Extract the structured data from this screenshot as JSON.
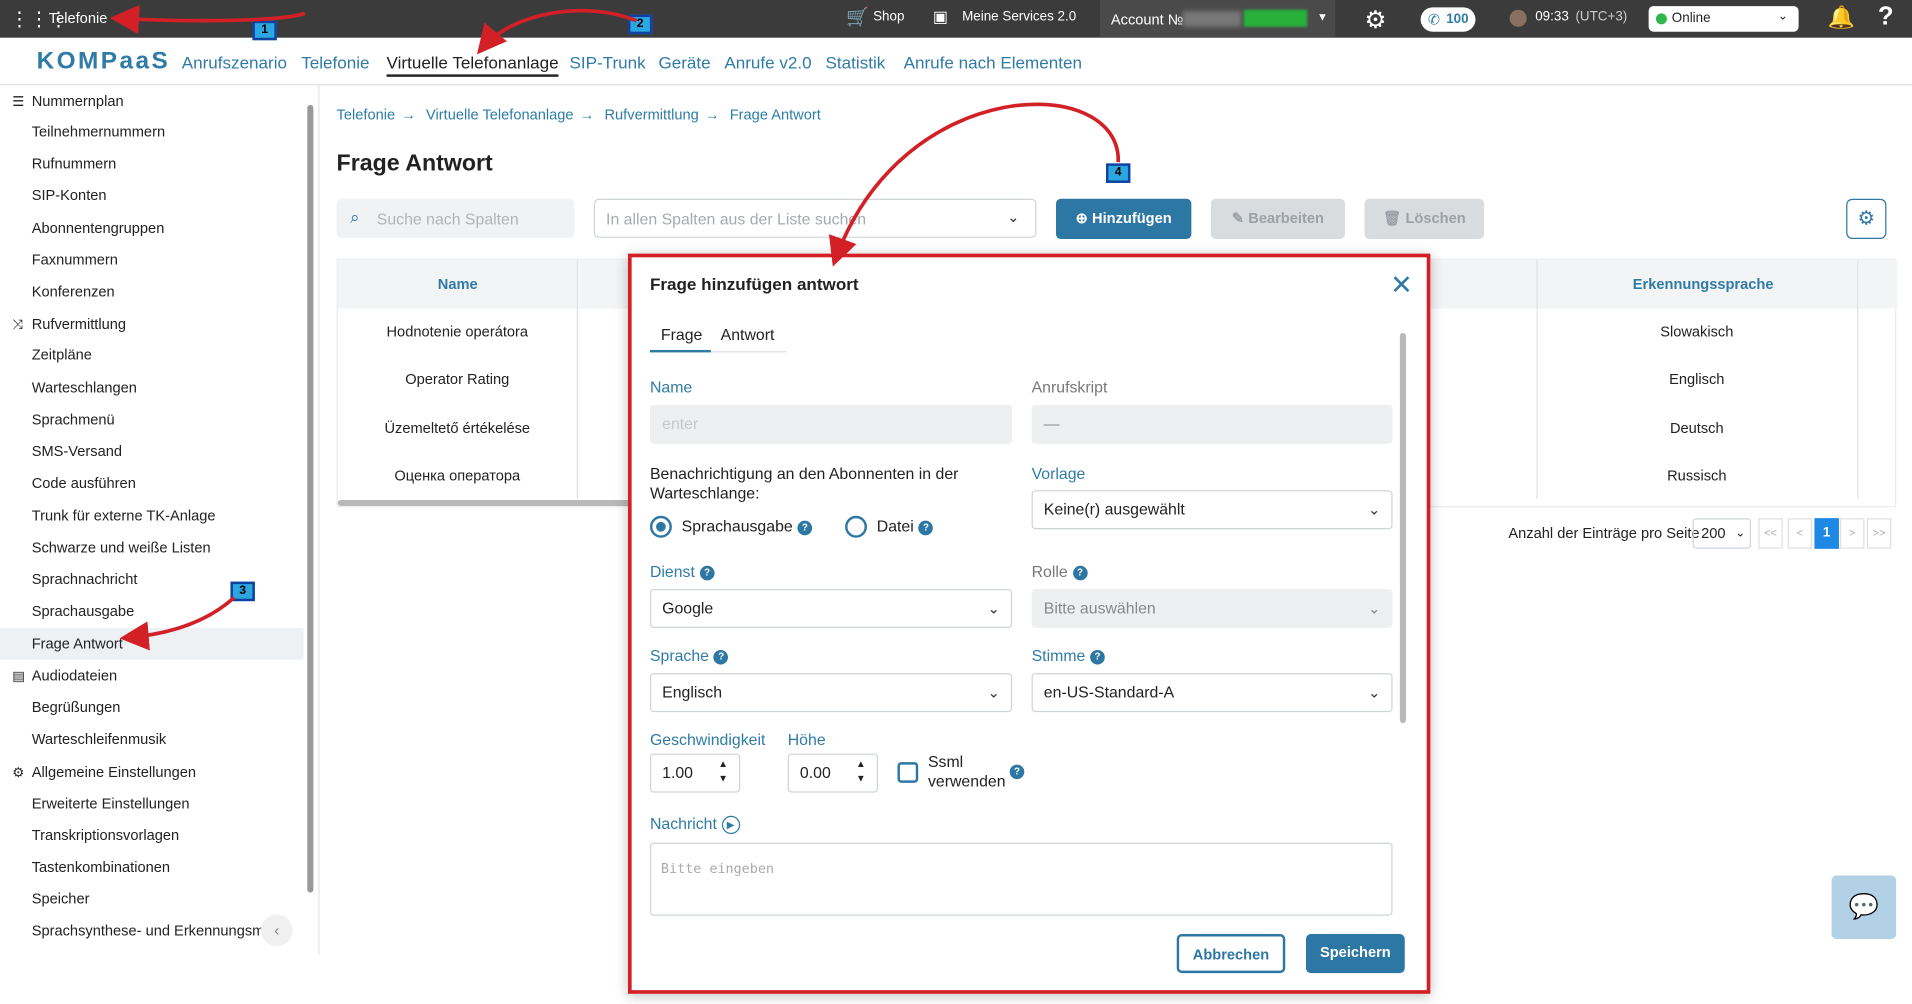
{
  "topbar": {
    "app_title": "Telefonie",
    "shop": "Shop",
    "services": "Meine Services 2.0",
    "account": "Account №",
    "calls_count": "100",
    "time": "09:33",
    "timezone": "(UTC+3)",
    "status": "Online",
    "icons": [
      "apps-grid-icon",
      "cart-icon",
      "services-icon",
      "gear-icon",
      "phone-icon",
      "user-avatar-icon",
      "bell-icon",
      "help-icon"
    ]
  },
  "nav": {
    "logo": "KOMPaaS",
    "items": [
      "Anrufszenario",
      "Telefonie",
      "Virtuelle Telefonanlage",
      "SIP-Trunk",
      "Geräte",
      "Anrufe v2.0",
      "Statistik",
      "Anrufe nach Elementen"
    ]
  },
  "sidebar": {
    "sections": [
      {
        "title": "Nummernplan",
        "items": [
          "Teilnehmernummern",
          "Rufnummern",
          "SIP-Konten",
          "Abonnentengruppen",
          "Faxnummern",
          "Konferenzen"
        ]
      },
      {
        "title": "Rufvermittlung",
        "items": [
          "Zeitpläne",
          "Warteschlangen",
          "Sprachmenü",
          "SMS-Versand",
          "Code ausführen",
          "Trunk für externe TK-Anlage",
          "Schwarze und weiße Listen",
          "Sprachnachricht",
          "Sprachausgabe",
          "Frage Antwort"
        ]
      },
      {
        "title": "Audiodateien",
        "items": [
          "Begrüßungen",
          "Warteschleifenmusik"
        ]
      },
      {
        "title": "Allgemeine Einstellungen",
        "items": [
          "Erweiterte Einstellungen",
          "Transkriptionsvorlagen",
          "Tastenkombinationen",
          "Speicher",
          "Sprachsynthese- und Erkennungsmus"
        ]
      }
    ]
  },
  "breadcrumb": [
    "Telefonie",
    "Virtuelle Telefonanlage",
    "Rufvermittlung",
    "Frage Antwort"
  ],
  "page_title": "Frage Antwort",
  "toolbar": {
    "search_placeholder": "Suche nach Spalten",
    "filter_placeholder": "In allen Spalten aus der Liste suchen",
    "add": "Hinzufügen",
    "edit": "Bearbeiten",
    "delete": "Löschen"
  },
  "table": {
    "columns": [
      "Name",
      "Erkennungssprache"
    ],
    "rows": [
      {
        "name": "Hodnotenie operátora",
        "lang": "Slowakisch"
      },
      {
        "name": "Operator Rating",
        "lang": "Englisch"
      },
      {
        "name": "Üzemeltető értékelése",
        "lang": "Deutsch"
      },
      {
        "name": "Оценка оператора",
        "lang": "Russisch"
      }
    ]
  },
  "pager": {
    "label": "Anzahl der Einträge pro Seite",
    "per_page": "200",
    "first": "<<",
    "prev": "<",
    "current": "1",
    "next": ">",
    "last": ">>"
  },
  "modal": {
    "title": "Frage hinzufügen antwort",
    "tabs": [
      "Frage",
      "Antwort"
    ],
    "name_label": "Name",
    "name_placeholder": "enter",
    "script_label": "Anrufskript",
    "script_value": "—",
    "notify_label": "Benachrichtigung an den Abonnenten in der Warteschlange:",
    "radio_tts": "Sprachausgabe",
    "radio_file": "Datei",
    "template_label": "Vorlage",
    "template_value": "Keine(r) ausgewählt",
    "service_label": "Dienst",
    "service_value": "Google",
    "role_label": "Rolle",
    "role_value": "Bitte auswählen",
    "language_label": "Sprache",
    "language_value": "Englisch",
    "voice_label": "Stimme",
    "voice_value": "en-US-Standard-A",
    "speed_label": "Geschwindigkeit",
    "speed_value": "1.00",
    "pitch_label": "Höhe",
    "pitch_value": "0.00",
    "ssml_label_1": "Ssml",
    "ssml_label_2": "verwenden",
    "message_label": "Nachricht",
    "message_placeholder": "Bitte eingeben",
    "cancel": "Abbrechen",
    "save": "Speichern"
  },
  "annotations": [
    "1",
    "2",
    "3",
    "4"
  ],
  "colors": {
    "accent": "#2d77a4",
    "highlight_border": "#d32026",
    "topbar": "#3b3b3b"
  }
}
